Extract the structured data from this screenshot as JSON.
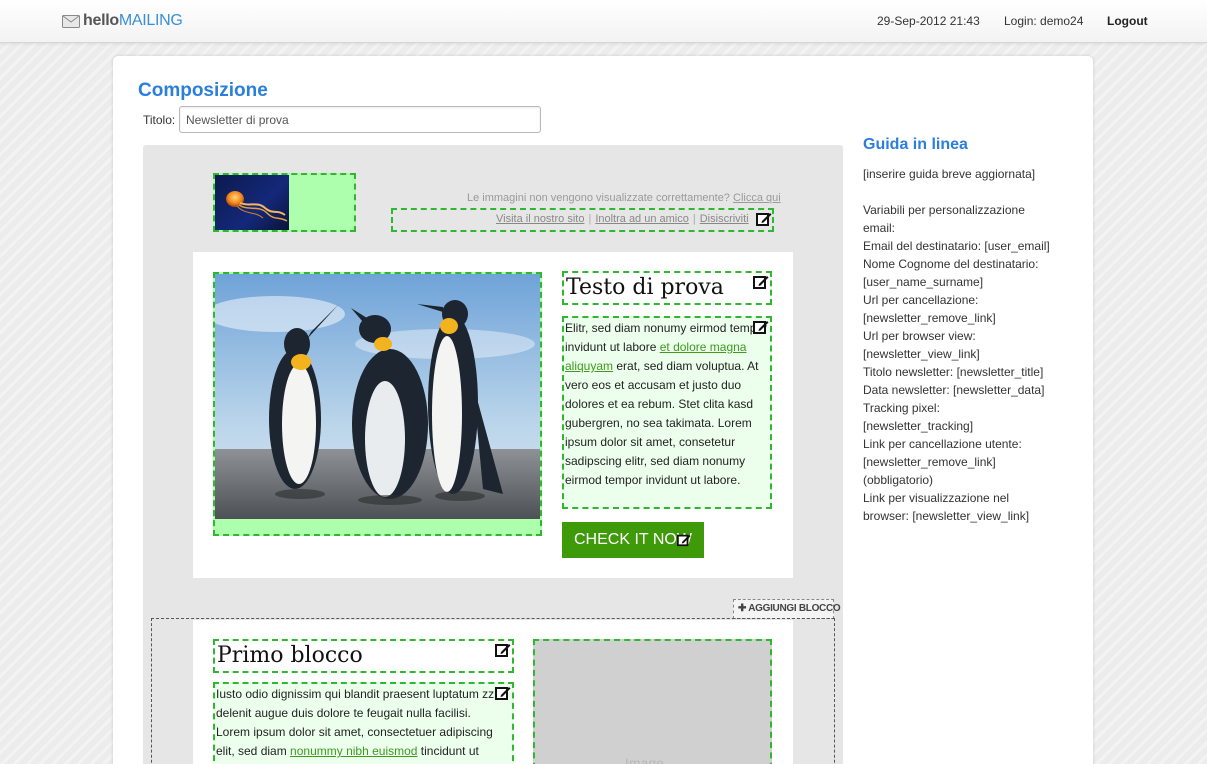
{
  "header": {
    "logo_hello": "hello",
    "logo_mailing": "MAILING",
    "datetime": "29-Sep-2012 21:43",
    "login": "Login: demo24",
    "logout": "Logout"
  },
  "page": {
    "title": "Composizione",
    "title_label": "Titolo:",
    "title_value": "Newsletter di prova"
  },
  "newsletter": {
    "image_notice": "Le immagini non vengono visualizzate correttamente?",
    "image_notice_link": "Clicca qui",
    "links": {
      "visit": "Visita il nostro sito",
      "forward": "Inoltra ad un amico",
      "unsubscribe": "Disiscriviti"
    },
    "block1": {
      "title": "Testo di prova",
      "text_before_link": "Elitr, sed diam nonumy eirmod tempor invidunt ut labore ",
      "link": "et dolore magna aliquyam",
      "text_after_link": " erat, sed diam voluptua. At vero eos et accusam et justo duo dolores et ea rebum. Stet clita kasd gubergren, no sea takimata. Lorem ipsum dolor sit amet, consetetur sadipscing elitr, sed diam nonumy eirmod tempor invidunt ut labore.",
      "button": "CHECK IT NOW"
    },
    "add_block": "AGGIUNGI BLOCCO",
    "block2": {
      "title": "Primo blocco",
      "text_before_link": "Iusto odio dignissim qui blandit praesent luptatum zzril delenit augue duis dolore te feugait nulla facilisi. Lorem ipsum dolor sit amet, consectetuer adipiscing elit, sed diam ",
      "link": "nonummy nibh euismod",
      "text_after_link": " tincidunt ut",
      "image_placeholder": "Image"
    }
  },
  "guide": {
    "title": "Guida in linea",
    "lines": [
      "[inserire guida breve aggiornata]",
      "",
      "Variabili per personalizzazione email:",
      "Email del destinatario: [user_email]",
      "Nome Cognome del destinatario: [user_name_surname]",
      "Url per cancellazione: [newsletter_remove_link]",
      "Url per browser view: [newsletter_view_link]",
      "Titolo newsletter: [newsletter_title]",
      "Data newsletter: [newsletter_data]",
      "Tracking pixel: [newsletter_tracking]",
      "Link per cancellazione utente: [newsletter_remove_link] (obbligatorio)",
      "Link per visualizzazione nel browser: [newsletter_view_link]"
    ]
  },
  "colors": {
    "accent": "#2a7fdb",
    "dropzone_border": "#2fb82f",
    "dropzone_fill": "#adffad",
    "button": "#3f9a0a",
    "link": "#3f9a1d"
  },
  "icons": [
    "mail-icon",
    "edit-icon",
    "plus-icon"
  ]
}
